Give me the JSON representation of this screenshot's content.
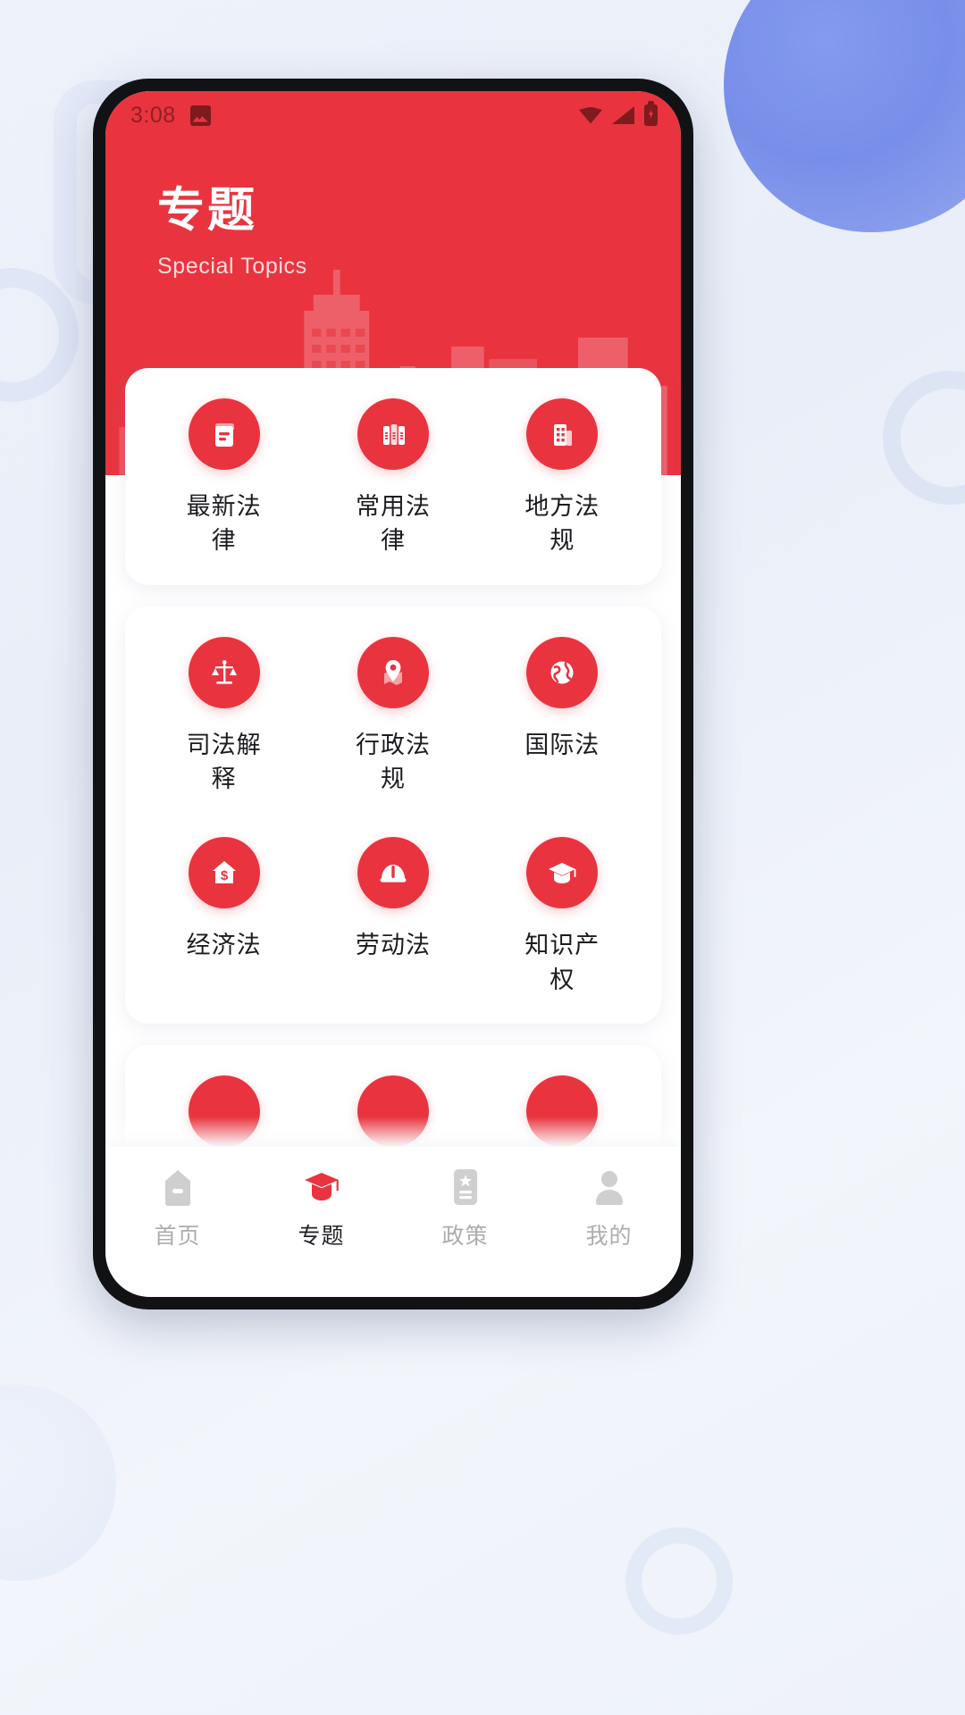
{
  "statusbar": {
    "time": "3:08",
    "image_icon": "image-icon",
    "wifi_icon": "wifi-icon",
    "signal_icon": "cellular-signal-icon",
    "battery_icon": "battery-charging-icon"
  },
  "header": {
    "title": "专题",
    "subtitle": "Special Topics",
    "background_color": "#e9343f"
  },
  "cards": [
    {
      "id": "card-basic-laws",
      "tiles": [
        {
          "label": "最新法律",
          "icon": "document-icon"
        },
        {
          "label": "常用法律",
          "icon": "books-icon"
        },
        {
          "label": "地方法规",
          "icon": "building-icon"
        }
      ]
    },
    {
      "id": "card-legal-domains",
      "tiles": [
        {
          "label": "司法解释",
          "icon": "scales-icon"
        },
        {
          "label": "行政法规",
          "icon": "map-pin-icon"
        },
        {
          "label": "国际法",
          "icon": "globe-icon"
        },
        {
          "label": "经济法",
          "icon": "house-dollar-icon"
        },
        {
          "label": "劳动法",
          "icon": "helmet-icon"
        },
        {
          "label": "知识产权",
          "icon": "graduation-cap-icon"
        }
      ]
    },
    {
      "id": "card-partial",
      "tiles": [
        {
          "label": "",
          "icon": "circle-icon"
        },
        {
          "label": "",
          "icon": "circle-icon"
        },
        {
          "label": "",
          "icon": "circle-icon"
        }
      ]
    }
  ],
  "tabbar": {
    "active_color": "#e9343f",
    "items": [
      {
        "label": "首页",
        "icon": "home-icon",
        "active": false
      },
      {
        "label": "专题",
        "icon": "graduation-cap-icon",
        "active": true
      },
      {
        "label": "政策",
        "icon": "policy-card-icon",
        "active": false
      },
      {
        "label": "我的",
        "icon": "person-icon",
        "active": false
      }
    ]
  }
}
